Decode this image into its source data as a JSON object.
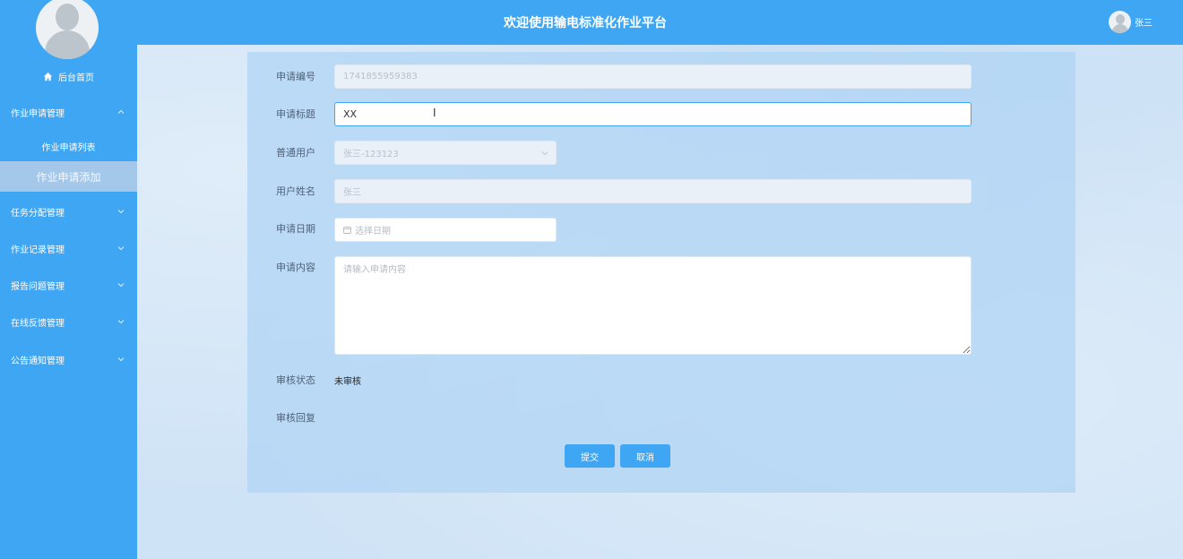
{
  "sidebar": {
    "home_label": "后台首页",
    "groups": [
      {
        "label": "作业申请管理",
        "expanded": true
      },
      {
        "label": "任务分配管理",
        "expanded": false
      },
      {
        "label": "作业记录管理",
        "expanded": false
      },
      {
        "label": "报告问题管理",
        "expanded": false
      },
      {
        "label": "在线反馈管理",
        "expanded": false
      },
      {
        "label": "公告通知管理",
        "expanded": false
      }
    ],
    "subitems": [
      {
        "label": "作业申请列表",
        "active": false
      },
      {
        "label": "作业申请添加",
        "active": true
      }
    ]
  },
  "header": {
    "title": "欢迎使用输电标准化作业平台",
    "username": "张三"
  },
  "form": {
    "app_no": {
      "label": "申请编号",
      "value": "1741855959383"
    },
    "title": {
      "label": "申请标题",
      "value": "XX"
    },
    "user": {
      "label": "普通用户",
      "value": "张三-123123"
    },
    "name": {
      "label": "用户姓名",
      "value": "张三"
    },
    "date": {
      "label": "申请日期",
      "placeholder": "选择日期"
    },
    "content": {
      "label": "申请内容",
      "placeholder": "请输入申请内容"
    },
    "status": {
      "label": "审核状态",
      "value": "未审核"
    },
    "reply": {
      "label": "审核回复"
    },
    "submit_label": "提交",
    "cancel_label": "取消"
  },
  "colors": {
    "primary": "#3ea6f3",
    "active_menu": "#a4c8ea"
  }
}
